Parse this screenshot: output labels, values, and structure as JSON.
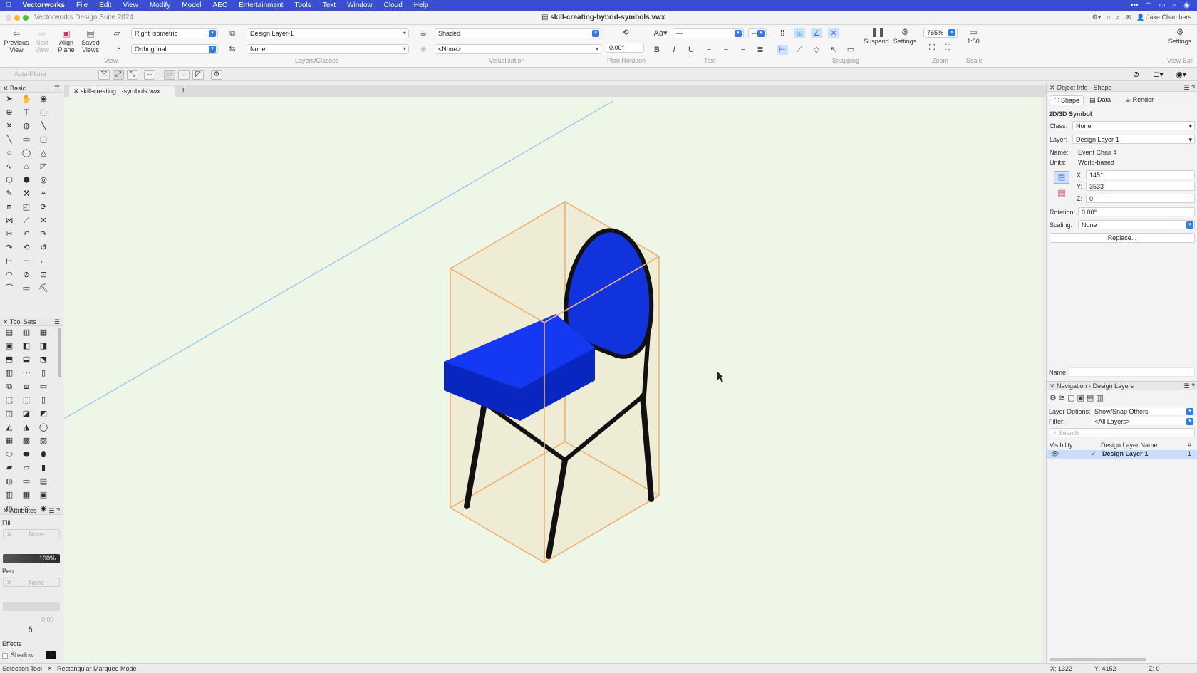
{
  "menubar": {
    "app_name": "Vectorworks",
    "items": [
      "File",
      "Edit",
      "View",
      "Modify",
      "Model",
      "AEC",
      "Entertainment",
      "Tools",
      "Text",
      "Window",
      "Cloud",
      "Help"
    ]
  },
  "titlebar": {
    "suite": "Vectorworks Design Suite 2024",
    "document": "skill-creating-hybrid-symbols.vwx",
    "user": "Jake Chambers"
  },
  "toolbar": {
    "previous_view": "Previous View",
    "next_view": "Next View",
    "align_plane": "Align Plane",
    "saved_views": "Saved Views",
    "view_value": "Right Isometric",
    "projection_value": "Orthogonal",
    "layer_value": "Design Layer-1",
    "class_value": "None",
    "render_value": "Shaded",
    "light_value": "<None>",
    "plan_rotation_value": "0.00°",
    "text_size_value": "---",
    "text_style_value": "---",
    "bold": "B",
    "italic": "I",
    "underline": "U",
    "suspend": "Suspend",
    "settings": "Settings",
    "zoom_value": "765%",
    "scale_value": "1:50",
    "settings_right": "Settings",
    "group_view": "View",
    "group_layers": "Layers/Classes",
    "group_visualization": "Visualization",
    "group_plan_rotation": "Plan Rotation",
    "group_text": "Text",
    "group_snapping": "Snapping",
    "group_zoom": "Zoom",
    "group_scale": "Scale",
    "group_viewbar": "View Bar"
  },
  "modebar": {
    "auto_plane": "Auto-Plane"
  },
  "palettes": {
    "basic_title": "Basic",
    "toolsets_title": "Tool Sets",
    "attributes_title": "Attributes",
    "fill_label": "Fill",
    "fill_value": "None",
    "opacity_value": "100%",
    "pen_label": "Pen",
    "pen_value": "None",
    "line_weight_value": "0.00",
    "effects_label": "Effects",
    "shadow_label": "Shadow"
  },
  "document_tab": {
    "label": "skill-creating...-symbols.vwx",
    "add": "+"
  },
  "object_info": {
    "title": "Object Info - Shape",
    "tabs": [
      "Shape",
      "Data",
      "Render"
    ],
    "object_type": "2D/3D Symbol",
    "class_label": "Class:",
    "class_value": "None",
    "layer_label": "Layer:",
    "layer_value": "Design Layer-1",
    "name_label": "Name:",
    "name_value": "Event Chair 4",
    "units_label": "Units:",
    "units_value": "World-based",
    "x_label": "X:",
    "x_value": "1451",
    "y_label": "Y:",
    "y_value": "3533",
    "z_label": "Z:",
    "z_value": "0",
    "rotation_label": "Rotation:",
    "rotation_value": "0.00°",
    "scaling_label": "Scaling:",
    "scaling_value": "None",
    "replace_button": "Replace...",
    "footer_name_label": "Name:"
  },
  "navigation": {
    "title": "Navigation - Design Layers",
    "layer_options_label": "Layer Options:",
    "layer_options_value": "Show/Snap Others",
    "filter_label": "Filter:",
    "filter_value": "<All Layers>",
    "search_placeholder": "Search",
    "col_visibility": "Visibility",
    "col_layer_name": "Design Layer Name",
    "col_number": "#",
    "rows": [
      {
        "name": "Design Layer-1",
        "number": "1",
        "check": "✓"
      }
    ]
  },
  "status": {
    "tool": "Selection Tool",
    "mode": "Rectangular Marquee Mode",
    "x": "X: 1322",
    "y": "Y: 4152",
    "z": "Z: 0"
  },
  "colors": {
    "menubar": "#3a4ed2",
    "canvas": "#eef6e8",
    "chair_blue": "#1133dd",
    "bbox_orange": "#f0b070",
    "accent": "#2b7df0",
    "selected_row": "#c9ddf8"
  }
}
